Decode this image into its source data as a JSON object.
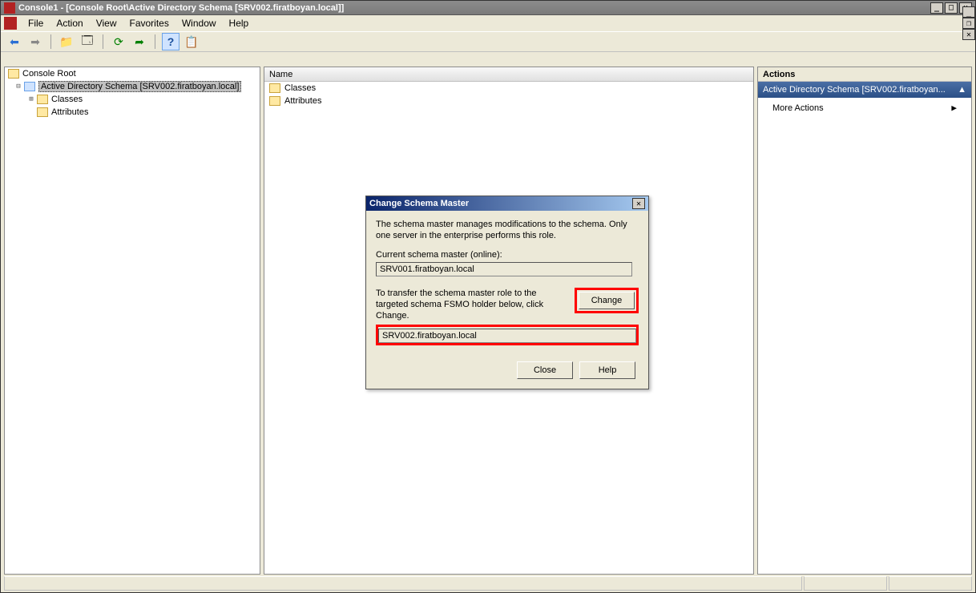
{
  "window": {
    "title": "Console1 - [Console Root\\Active Directory Schema [SRV002.firatboyan.local]]"
  },
  "menu": {
    "file": "File",
    "action": "Action",
    "view": "View",
    "favorites": "Favorites",
    "window": "Window",
    "help": "Help"
  },
  "tree": {
    "root": "Console Root",
    "schema": "Active Directory Schema [SRV002.firatboyan.local]",
    "classes": "Classes",
    "attributes": "Attributes"
  },
  "list": {
    "header_name": "Name",
    "row_classes": "Classes",
    "row_attributes": "Attributes"
  },
  "actions": {
    "header": "Actions",
    "title": "Active Directory Schema [SRV002.firatboyan...",
    "more": "More Actions"
  },
  "dialog": {
    "title": "Change Schema Master",
    "desc": "The schema master manages modifications to the schema. Only one server in the enterprise performs this role.",
    "current_label": "Current schema master (online):",
    "current_value": "SRV001.firatboyan.local",
    "transfer_text": "To transfer the schema master role to the targeted schema FSMO holder below, click Change.",
    "change_btn": "Change",
    "target_value": "SRV002.firatboyan.local",
    "close_btn": "Close",
    "help_btn": "Help"
  }
}
